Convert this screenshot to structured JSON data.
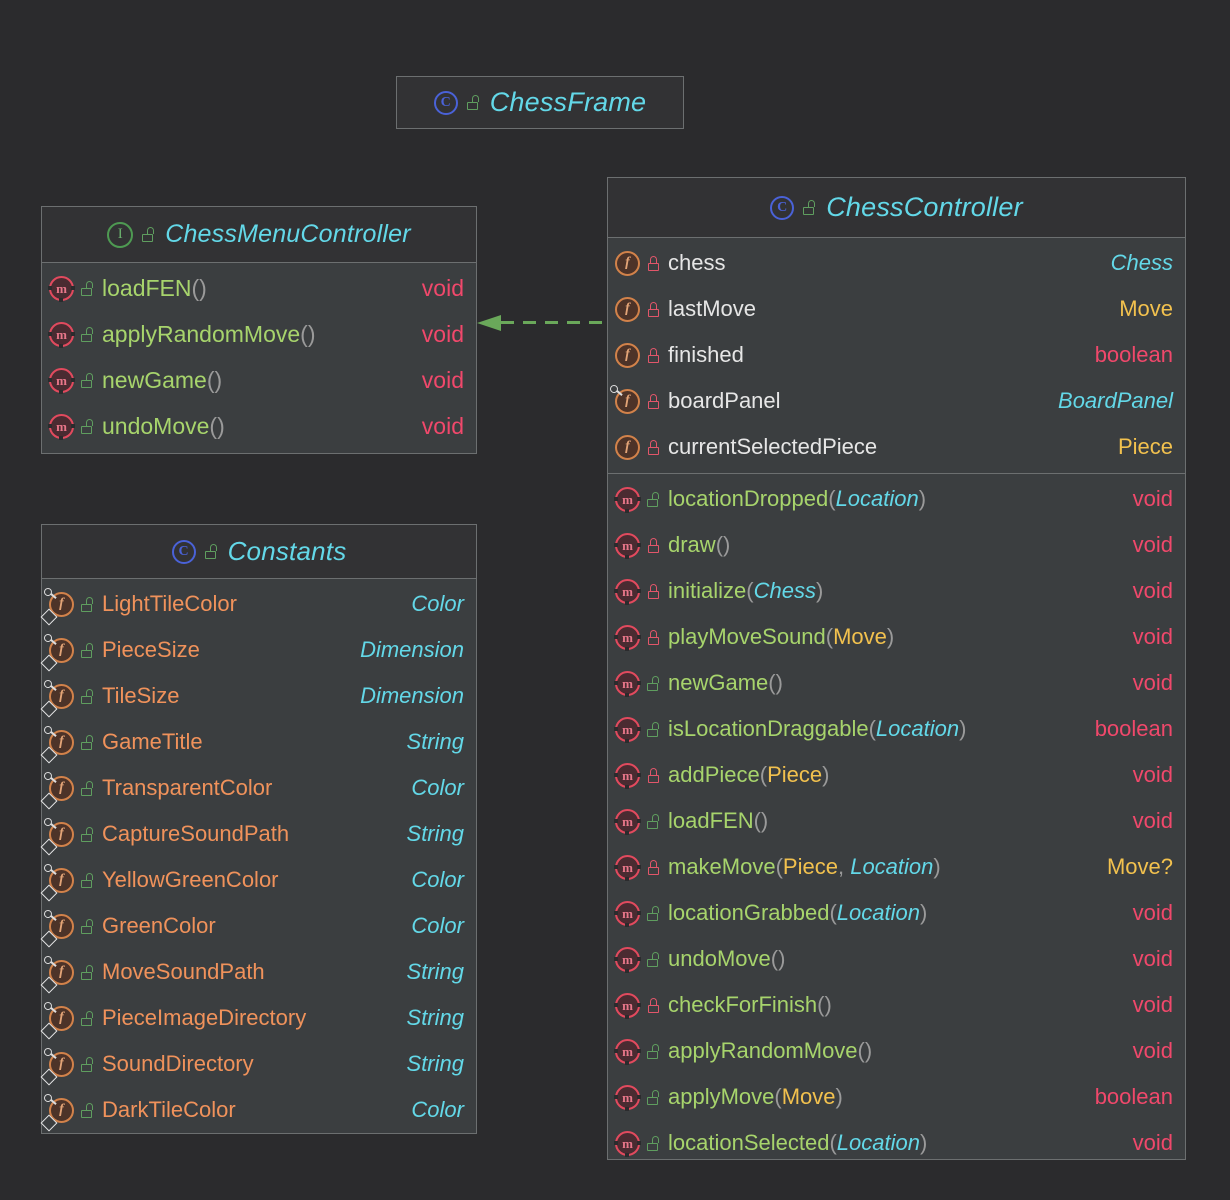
{
  "diagram": {
    "kind": "uml-class-diagram",
    "background_color": "#2b2b2d",
    "relationship": {
      "name": "realization",
      "from": "ChessController",
      "to": "ChessMenuController",
      "line_style": "dashed",
      "arrow": "hollow-triangle-filled",
      "color": "#6aa85a"
    }
  },
  "chess_frame": {
    "stereotype_icon": "class-icon",
    "visibility_icon": "unlocked-icon",
    "name": "ChessFrame"
  },
  "chess_menu_controller": {
    "stereotype_icon": "interface-icon",
    "visibility_icon": "unlocked-icon",
    "name": "ChessMenuController",
    "members": [
      {
        "icon": "method-icon",
        "lock": "unlocked-icon",
        "name": "loadFEN",
        "params": [],
        "ret": "void",
        "ret_style": "void"
      },
      {
        "icon": "method-icon",
        "lock": "unlocked-icon",
        "name": "applyRandomMove",
        "params": [],
        "ret": "void",
        "ret_style": "void"
      },
      {
        "icon": "method-icon",
        "lock": "unlocked-icon",
        "name": "newGame",
        "params": [],
        "ret": "void",
        "ret_style": "void"
      },
      {
        "icon": "method-icon",
        "lock": "unlocked-icon",
        "name": "undoMove",
        "params": [],
        "ret": "void",
        "ret_style": "void"
      }
    ]
  },
  "constants": {
    "stereotype_icon": "class-icon",
    "visibility_icon": "unlocked-icon",
    "name": "Constants",
    "fields": [
      {
        "icon": "static-final-field-icon",
        "lock": "unlocked-icon",
        "name": "LightTileColor",
        "type": "Color"
      },
      {
        "icon": "static-final-field-icon",
        "lock": "unlocked-icon",
        "name": "PieceSize",
        "type": "Dimension"
      },
      {
        "icon": "static-final-field-icon",
        "lock": "unlocked-icon",
        "name": "TileSize",
        "type": "Dimension"
      },
      {
        "icon": "static-final-field-icon",
        "lock": "unlocked-icon",
        "name": "GameTitle",
        "type": "String"
      },
      {
        "icon": "static-final-field-icon",
        "lock": "unlocked-icon",
        "name": "TransparentColor",
        "type": "Color"
      },
      {
        "icon": "static-final-field-icon",
        "lock": "unlocked-icon",
        "name": "CaptureSoundPath",
        "type": "String"
      },
      {
        "icon": "static-final-field-icon",
        "lock": "unlocked-icon",
        "name": "YellowGreenColor",
        "type": "Color"
      },
      {
        "icon": "static-final-field-icon",
        "lock": "unlocked-icon",
        "name": "GreenColor",
        "type": "Color"
      },
      {
        "icon": "static-final-field-icon",
        "lock": "unlocked-icon",
        "name": "MoveSoundPath",
        "type": "String"
      },
      {
        "icon": "static-final-field-icon",
        "lock": "unlocked-icon",
        "name": "PieceImageDirectory",
        "type": "String"
      },
      {
        "icon": "static-final-field-icon",
        "lock": "unlocked-icon",
        "name": "SoundDirectory",
        "type": "String"
      },
      {
        "icon": "static-final-field-icon",
        "lock": "unlocked-icon",
        "name": "DarkTileColor",
        "type": "Color"
      }
    ]
  },
  "chess_controller": {
    "stereotype_icon": "class-icon",
    "visibility_icon": "unlocked-icon",
    "name": "ChessController",
    "fields": [
      {
        "icon": "field-icon",
        "lock": "locked-icon",
        "name": "chess",
        "type": "Chess",
        "type_style": "cyan"
      },
      {
        "icon": "field-icon",
        "lock": "locked-icon",
        "name": "lastMove",
        "type": "Move",
        "type_style": "yellow"
      },
      {
        "icon": "field-icon",
        "lock": "locked-icon",
        "name": "finished",
        "type": "boolean",
        "type_style": "keyword"
      },
      {
        "icon": "final-field-icon",
        "lock": "locked-icon",
        "name": "boardPanel",
        "type": "BoardPanel",
        "type_style": "cyan"
      },
      {
        "icon": "field-icon",
        "lock": "locked-icon",
        "name": "currentSelectedPiece",
        "type": "Piece",
        "type_style": "yellow"
      }
    ],
    "methods": [
      {
        "icon": "method-icon",
        "lock": "unlocked-icon",
        "name": "locationDropped",
        "params": [
          {
            "text": "Location",
            "style": "cyan"
          }
        ],
        "ret": "void",
        "ret_style": "void"
      },
      {
        "icon": "method-icon",
        "lock": "locked-icon",
        "name": "draw",
        "params": [],
        "ret": "void",
        "ret_style": "void"
      },
      {
        "icon": "method-icon",
        "lock": "locked-icon",
        "name": "initialize",
        "params": [
          {
            "text": "Chess",
            "style": "cyan"
          }
        ],
        "ret": "void",
        "ret_style": "void"
      },
      {
        "icon": "method-icon",
        "lock": "locked-icon",
        "name": "playMoveSound",
        "params": [
          {
            "text": "Move",
            "style": "yellow"
          }
        ],
        "ret": "void",
        "ret_style": "void"
      },
      {
        "icon": "method-icon",
        "lock": "unlocked-icon",
        "name": "newGame",
        "params": [],
        "ret": "void",
        "ret_style": "void"
      },
      {
        "icon": "method-icon",
        "lock": "unlocked-icon",
        "name": "isLocationDraggable",
        "params": [
          {
            "text": "Location",
            "style": "cyan"
          }
        ],
        "ret": "boolean",
        "ret_style": "keyword"
      },
      {
        "icon": "method-icon",
        "lock": "locked-icon",
        "name": "addPiece",
        "params": [
          {
            "text": "Piece",
            "style": "yellow"
          }
        ],
        "ret": "void",
        "ret_style": "void"
      },
      {
        "icon": "method-icon",
        "lock": "unlocked-icon",
        "name": "loadFEN",
        "params": [],
        "ret": "void",
        "ret_style": "void"
      },
      {
        "icon": "method-icon",
        "lock": "locked-icon",
        "name": "makeMove",
        "params": [
          {
            "text": "Piece",
            "style": "yellow"
          },
          {
            "text": "Location",
            "style": "cyan"
          }
        ],
        "ret": "Move?",
        "ret_style": "yellow"
      },
      {
        "icon": "method-icon",
        "lock": "unlocked-icon",
        "name": "locationGrabbed",
        "params": [
          {
            "text": "Location",
            "style": "cyan"
          }
        ],
        "ret": "void",
        "ret_style": "void"
      },
      {
        "icon": "method-icon",
        "lock": "unlocked-icon",
        "name": "undoMove",
        "params": [],
        "ret": "void",
        "ret_style": "void"
      },
      {
        "icon": "method-icon",
        "lock": "locked-icon",
        "name": "checkForFinish",
        "params": [],
        "ret": "void",
        "ret_style": "void"
      },
      {
        "icon": "method-icon",
        "lock": "unlocked-icon",
        "name": "applyRandomMove",
        "params": [],
        "ret": "void",
        "ret_style": "void"
      },
      {
        "icon": "method-icon",
        "lock": "unlocked-icon",
        "name": "applyMove",
        "params": [
          {
            "text": "Move",
            "style": "yellow"
          }
        ],
        "ret": "boolean",
        "ret_style": "keyword"
      },
      {
        "icon": "method-icon",
        "lock": "unlocked-icon",
        "name": "locationSelected",
        "params": [
          {
            "text": "Location",
            "style": "cyan"
          }
        ],
        "ret": "void",
        "ret_style": "void"
      }
    ]
  }
}
